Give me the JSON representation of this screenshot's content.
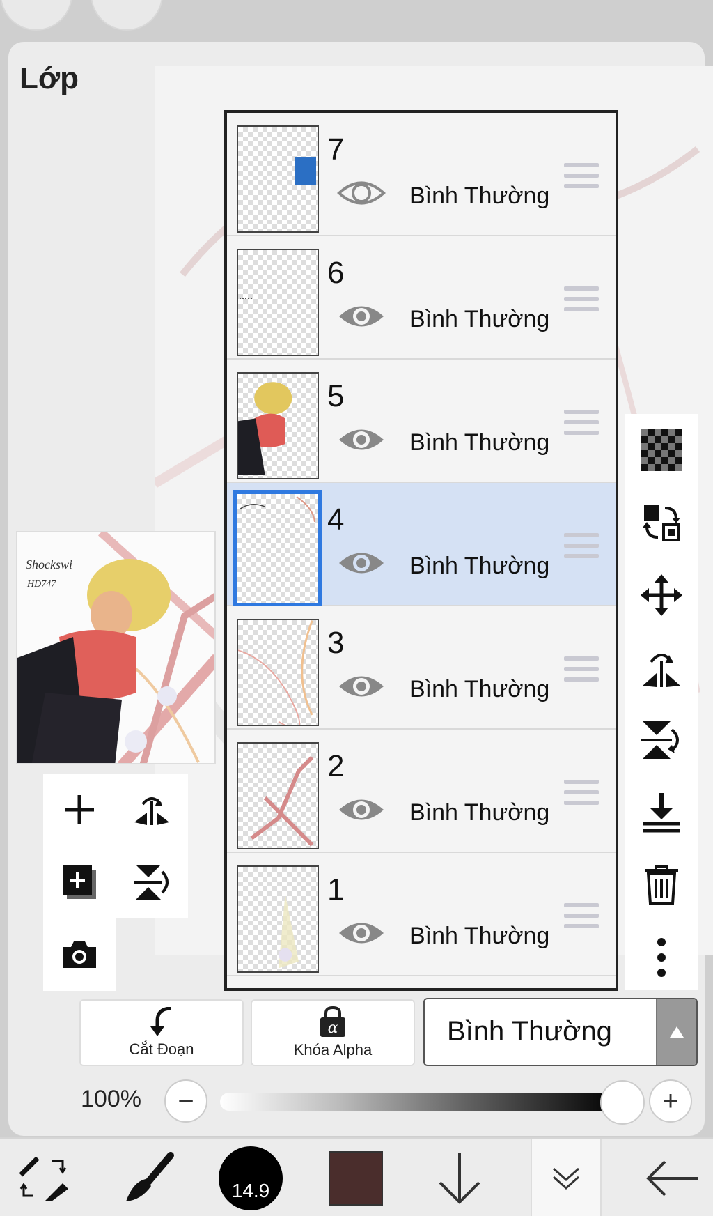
{
  "panel": {
    "title": "Lớp"
  },
  "preview": {
    "signature": "Shockswi",
    "signature2": "HD747"
  },
  "layers": [
    {
      "number": "7",
      "blend": "Bình Thường",
      "visible": true
    },
    {
      "number": "6",
      "blend": "Bình Thường",
      "visible": true
    },
    {
      "number": "5",
      "blend": "Bình Thường",
      "visible": true
    },
    {
      "number": "4",
      "blend": "Bình Thường",
      "visible": true,
      "selected": true
    },
    {
      "number": "3",
      "blend": "Bình Thường",
      "visible": true
    },
    {
      "number": "2",
      "blend": "Bình Thường",
      "visible": true
    },
    {
      "number": "1",
      "blend": "Bình Thường",
      "visible": true
    }
  ],
  "bottom_buttons": {
    "clip_label": "Cắt Đoạn",
    "alpha_lock_label": "Khóa Alpha",
    "blend_mode_value": "Bình Thường"
  },
  "opacity": {
    "label": "100%",
    "minus": "−",
    "plus": "+",
    "value": 1.0
  },
  "toolbar": {
    "brush_size": "14.9",
    "color": "#4a2d2c"
  },
  "icons": {
    "left": [
      "add-layer-icon",
      "flip-horizontal-icon",
      "add-copy-layer-icon",
      "flip-vertical-icon",
      "camera-icon"
    ],
    "right": [
      "transparency-checker-icon",
      "layer-swap-icon",
      "move-icon",
      "flip-horizontal-icon",
      "flip-vertical-icon",
      "merge-down-icon",
      "trash-icon",
      "more-icon"
    ]
  }
}
